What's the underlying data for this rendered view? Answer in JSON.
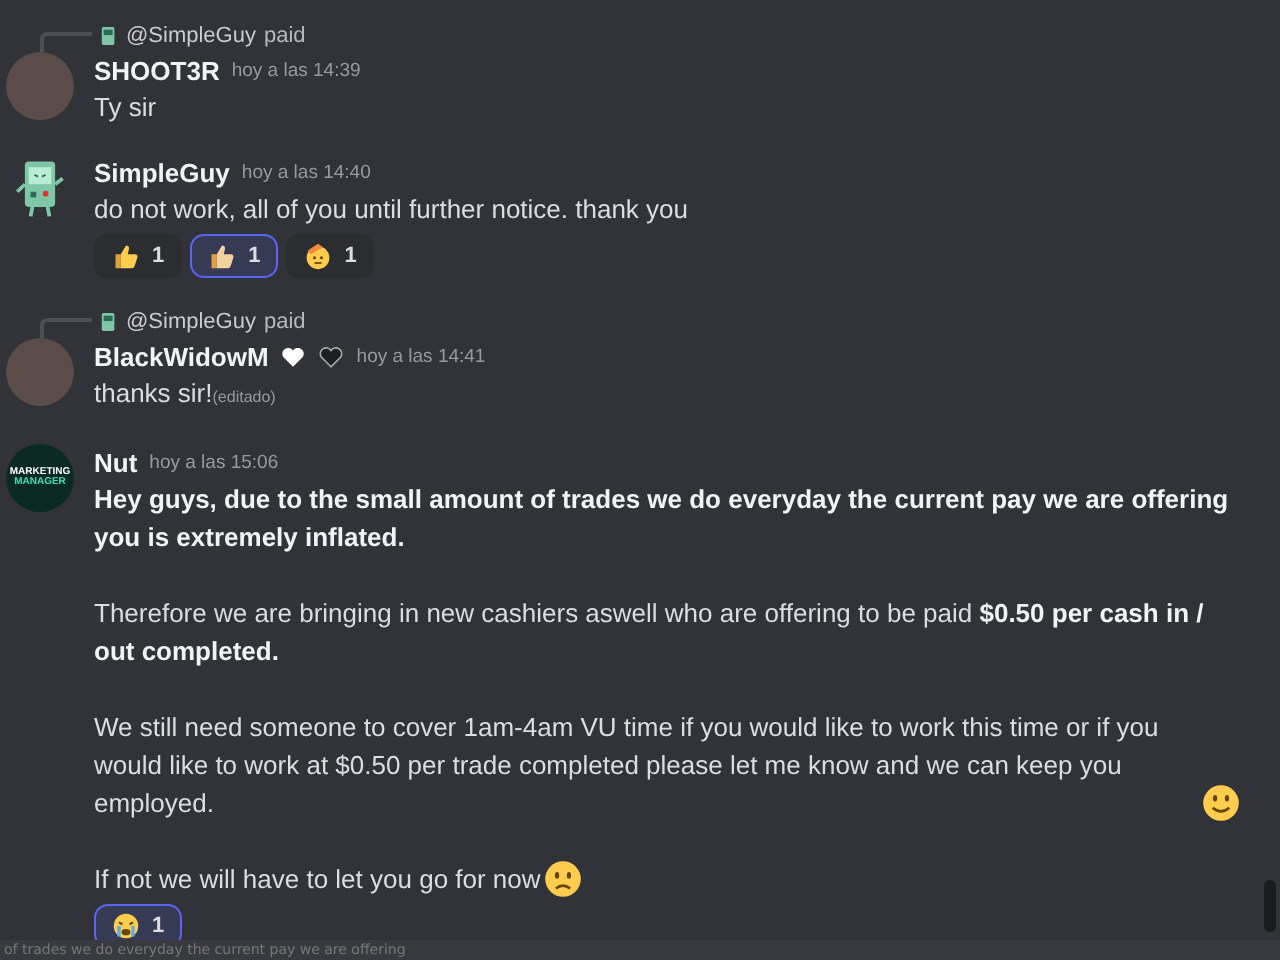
{
  "messages": [
    {
      "reply": {
        "mention": "@SimpleGuy",
        "text": "paid"
      },
      "author": "SHOOT3R",
      "time": "hoy a las 14:39",
      "avatar": {
        "kind": "photo"
      },
      "paragraphs": [
        {
          "text": "Ty sir",
          "bold": false
        }
      ]
    },
    {
      "author": "SimpleGuy",
      "time": "hoy a las 14:40",
      "avatar": {
        "kind": "robot"
      },
      "paragraphs": [
        {
          "text": "do not work, all of you until further notice. thank you",
          "bold": false
        }
      ],
      "reactions": [
        {
          "kind": "thumbs-up",
          "count": "1",
          "selected": false
        },
        {
          "kind": "thumbs-up-light",
          "count": "1",
          "selected": true
        },
        {
          "kind": "salute-face",
          "count": "1",
          "selected": false
        }
      ]
    },
    {
      "reply": {
        "mention": "@SimpleGuy",
        "text": "paid"
      },
      "author": "BlackWidowM",
      "badges": [
        {
          "kind": "white-heart"
        },
        {
          "kind": "black-heart"
        }
      ],
      "time": "hoy a las 14:41",
      "avatar": {
        "kind": "photo"
      },
      "paragraphs": [
        {
          "text": "thanks sir!",
          "bold": false
        }
      ],
      "edited": "(editado)"
    },
    {
      "author": "Nut",
      "time": "hoy a las 15:06",
      "avatar": {
        "kind": "logo",
        "text": [
          "MARKETING",
          "MANAGER"
        ]
      },
      "paragraphs": [
        {
          "text": "Hey guys, due to the small amount of trades we do everyday the current pay we are offering you is extremely inflated.",
          "bold": true
        },
        {
          "text": "Therefore we are bringing in new cashiers aswell who are offering to be paid **$0.50 per cash in / out completed.**",
          "bold": false
        },
        {
          "text": "We still need someone to cover 1am-4am VU time if you would like to work this time or if you would like to work at $0.50 per trade completed please let me know and we can keep you employed.",
          "bold": false,
          "emoji": {
            "kind": "smile"
          }
        },
        {
          "text": "If not we will have to let you go for now",
          "bold": false,
          "emoji": {
            "kind": "frown"
          }
        }
      ],
      "reactions": [
        {
          "kind": "crying-face",
          "count": "1",
          "selected": true
        }
      ]
    }
  ],
  "composer_preview": "of trades we do everyday the current pay we are offering"
}
